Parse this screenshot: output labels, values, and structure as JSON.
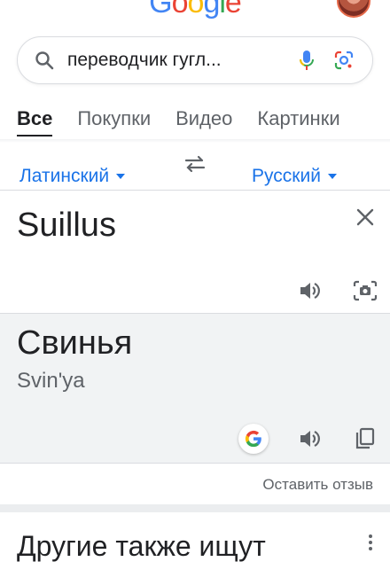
{
  "header": {
    "logo_letters": [
      {
        "char": "G",
        "color": "#4285F4"
      },
      {
        "char": "o",
        "color": "#EA4335"
      },
      {
        "char": "o",
        "color": "#FBBC05"
      },
      {
        "char": "g",
        "color": "#4285F4"
      },
      {
        "char": "l",
        "color": "#34A853"
      },
      {
        "char": "e",
        "color": "#EA4335"
      }
    ],
    "avatar_icon": "user-avatar"
  },
  "search": {
    "query": "переводчик гугл...",
    "icons": [
      "search-icon",
      "microphone-icon",
      "google-lens-icon"
    ]
  },
  "tabs": [
    {
      "label": "Все",
      "active": true
    },
    {
      "label": "Покупки",
      "active": false
    },
    {
      "label": "Видео",
      "active": false
    },
    {
      "label": "Картинки",
      "active": false
    }
  ],
  "translator": {
    "source_language": "Латинский",
    "target_language": "Русский",
    "source_text": "Suillus",
    "translation": "Свинья",
    "transliteration": "Svin'ya",
    "feedback_label": "Оставить отзыв",
    "accent_color": "#1a73e8"
  },
  "related": {
    "title": "Другие также ищут"
  }
}
